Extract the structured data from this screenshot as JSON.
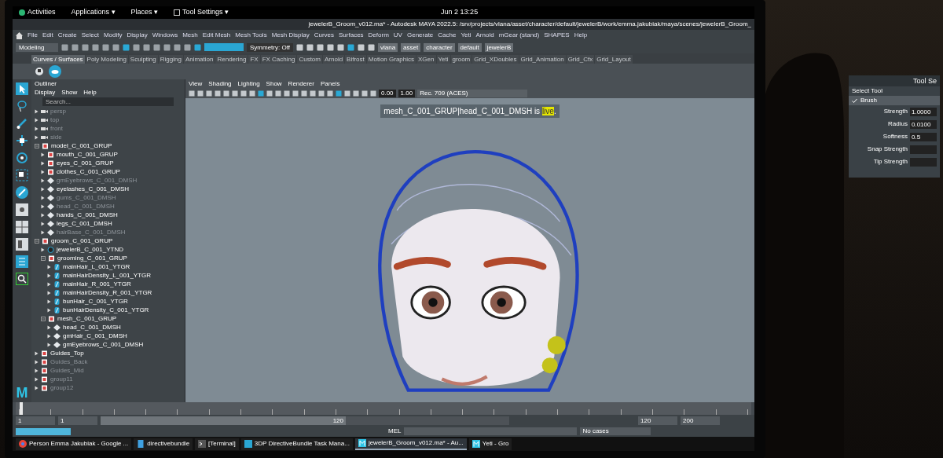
{
  "top_bar": {
    "items": [
      "Activities",
      "Applications ▾",
      "Places ▾",
      "Tool Settings ▾"
    ],
    "clock": "Jun 2 13:25"
  },
  "window": {
    "title": "jewelerB_Groom_v012.ma* - Autodesk MAYA 2022.5: /srv/projects/vlana/asset/character/default/jewelerB/work/emma.jakubiak/maya/scenes/jewelerB_Groom_"
  },
  "menu": [
    "File",
    "Edit",
    "Create",
    "Select",
    "Modify",
    "Display",
    "Windows",
    "Mesh",
    "Edit Mesh",
    "Mesh Tools",
    "Mesh Display",
    "Curves",
    "Surfaces",
    "Deform",
    "UV",
    "Generate",
    "Cache",
    "Yeti",
    "Arnold",
    "mGear (stand)",
    "SHAPES",
    "Help"
  ],
  "status_line": {
    "mode": "Modeling",
    "symmetry": "Symmetry: Off",
    "path": [
      "vlana",
      "asset",
      "character",
      "default",
      "jewelerB"
    ]
  },
  "shelf_tabs": [
    {
      "label": "Curves / Surfaces",
      "selected": true
    },
    {
      "label": "Poly Modeling",
      "selected": false
    },
    {
      "label": "Sculpting",
      "selected": false
    },
    {
      "label": "Rigging",
      "selected": false
    },
    {
      "label": "Animation",
      "selected": false
    },
    {
      "label": "Rendering",
      "selected": false
    },
    {
      "label": "FX",
      "selected": false
    },
    {
      "label": "FX Caching",
      "selected": false
    },
    {
      "label": "Custom",
      "selected": false
    },
    {
      "label": "Arnold",
      "selected": false
    },
    {
      "label": "Bifrost",
      "selected": false
    },
    {
      "label": "Motion Graphics",
      "selected": false
    },
    {
      "label": "XGen",
      "selected": false
    },
    {
      "label": "Yeti",
      "selected": false
    },
    {
      "label": "groom",
      "selected": false
    },
    {
      "label": "Grid_XDoubles",
      "selected": false
    },
    {
      "label": "Grid_Animation",
      "selected": false
    },
    {
      "label": "Grid_Cfx",
      "selected": false
    },
    {
      "label": "Grid_Layout",
      "selected": false
    }
  ],
  "outliner": {
    "title": "Outliner",
    "menu": [
      "Display",
      "Show",
      "Help"
    ],
    "search": {
      "placeholder": "Search..."
    },
    "items": [
      {
        "label": "persp",
        "kind": "camera",
        "dimmed": true
      },
      {
        "label": "top",
        "kind": "camera",
        "dimmed": true
      },
      {
        "label": "front",
        "kind": "camera",
        "dimmed": true
      },
      {
        "label": "side",
        "kind": "camera",
        "dimmed": true
      },
      {
        "label": "model_C_001_GRUP",
        "kind": "group",
        "dimmed": false,
        "children": [
          {
            "label": "mouth_C_001_GRUP",
            "kind": "group",
            "dimmed": false
          },
          {
            "label": "eyes_C_001_GRUP",
            "kind": "group",
            "dimmed": false
          },
          {
            "label": "clothes_C_001_GRUP",
            "kind": "group",
            "dimmed": false
          },
          {
            "label": "gmEyebrows_C_001_DMSH",
            "kind": "mesh",
            "dimmed": true
          },
          {
            "label": "eyelashes_C_001_DMSH",
            "kind": "mesh",
            "dimmed": false
          },
          {
            "label": "gums_C_001_DMSH",
            "kind": "mesh",
            "dimmed": true
          },
          {
            "label": "head_C_001_DMSH",
            "kind": "mesh",
            "dimmed": true
          },
          {
            "label": "hands_C_001_DMSH",
            "kind": "mesh",
            "dimmed": false
          },
          {
            "label": "legs_C_001_DMSH",
            "kind": "mesh",
            "dimmed": false
          },
          {
            "label": "hairBase_C_001_DMSH",
            "kind": "mesh",
            "dimmed": true
          }
        ]
      },
      {
        "label": "groom_C_001_GRUP",
        "kind": "group",
        "dimmed": false,
        "children": [
          {
            "label": "jewelerB_C_001_YTND",
            "kind": "node",
            "dimmed": false
          },
          {
            "label": "grooming_C_001_GRUP",
            "kind": "group",
            "dimmed": false,
            "children": [
              {
                "label": "mainHair_L_001_YTGR",
                "kind": "groom",
                "dimmed": false
              },
              {
                "label": "mainHairDensity_L_001_YTGR",
                "kind": "groom",
                "dimmed": false
              },
              {
                "label": "mainHair_R_001_YTGR",
                "kind": "groom",
                "dimmed": false
              },
              {
                "label": "mainHairDensity_R_001_YTGR",
                "kind": "groom",
                "dimmed": false
              },
              {
                "label": "bunHair_C_001_YTGR",
                "kind": "groom",
                "dimmed": false
              },
              {
                "label": "bunHairDensity_C_001_YTGR",
                "kind": "groom",
                "dimmed": false
              }
            ]
          },
          {
            "label": "mesh_C_001_GRUP",
            "kind": "group",
            "dimmed": false,
            "children": [
              {
                "label": "head_C_001_DMSH",
                "kind": "mesh",
                "dimmed": false
              },
              {
                "label": "gmHair_C_001_DMSH",
                "kind": "mesh",
                "dimmed": false
              },
              {
                "label": "gmEyebrows_C_001_DMSH",
                "kind": "mesh",
                "dimmed": false
              }
            ]
          }
        ]
      },
      {
        "label": "Guides_Top",
        "kind": "group",
        "dimmed": false
      },
      {
        "label": "Guides_Back",
        "kind": "group",
        "dimmed": true
      },
      {
        "label": "Guides_Mid",
        "kind": "group",
        "dimmed": true
      },
      {
        "label": "group11",
        "kind": "group",
        "dimmed": true
      },
      {
        "label": "group12",
        "kind": "group",
        "dimmed": true
      }
    ]
  },
  "viewport": {
    "menu": [
      "View",
      "Shading",
      "Lighting",
      "Show",
      "Renderer",
      "Panels"
    ],
    "fields": [
      "0.00",
      "1.00"
    ],
    "color_space": "Rec. 709 (ACES)",
    "message": "mesh_C_001_GRUP|head_C_001_DMSH is",
    "message_highlight": "live",
    "message_end": "."
  },
  "logo": "M",
  "timeline": {
    "playhead": {
      "level": 0
    },
    "range_bar": {
      "level": 0.6
    },
    "start": "1",
    "range_start": "1",
    "range_label": "120",
    "end": "120",
    "range_end": "200",
    "cmd": "MEL",
    "status": "No cases"
  },
  "taskbar": [
    {
      "label": "Person Emma Jakubiak - Google ...",
      "kind": "browser",
      "selected": false
    },
    {
      "label": "directivebundle",
      "kind": "folder",
      "selected": false
    },
    {
      "label": "[Terminal]",
      "kind": "terminal",
      "selected": false
    },
    {
      "label": "3DP DirectiveBundle Task Mana...",
      "kind": "app",
      "selected": false
    },
    {
      "label": "jewelerB_Groom_v012.ma* - Au...",
      "kind": "maya",
      "selected": true
    },
    {
      "label": "Yeti - Gro",
      "kind": "maya",
      "selected": false
    }
  ],
  "second_monitor": {
    "title": "Tool Se",
    "section": "Select Tool",
    "brush": "Brush",
    "rows": [
      {
        "label": "Strength",
        "value": "1.0000"
      },
      {
        "label": "Radius",
        "value": "0.0100"
      },
      {
        "label": "Softness",
        "value": "0.5"
      },
      {
        "label": "Snap Strength",
        "value": ""
      },
      {
        "label": "Tip Strength",
        "value": ""
      }
    ]
  }
}
